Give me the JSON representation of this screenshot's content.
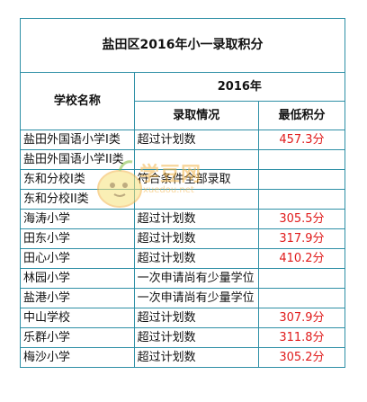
{
  "table": {
    "title": "盐田区2016年小一录取积分",
    "header": {
      "school_name": "学校名称",
      "year": "2016年",
      "admission": "录取情况",
      "min_score": "最低积分"
    },
    "rows": [
      {
        "school": "盐田外国语小学I类",
        "status": "超过计划数",
        "score": "457.3分"
      },
      {
        "school": "盐田外国语小学II类",
        "status": "",
        "score": ""
      },
      {
        "school": "东和分校I类",
        "status": "符合条件全部录取",
        "score": ""
      },
      {
        "school": "东和分校II类",
        "status": "",
        "score": ""
      },
      {
        "school": "海涛小学",
        "status": "超过计划数",
        "score": "305.5分"
      },
      {
        "school": "田东小学",
        "status": "超过计划数",
        "score": "317.9分"
      },
      {
        "school": "田心小学",
        "status": "超过计划数",
        "score": "410.2分"
      },
      {
        "school": "林园小学",
        "status": "一次申请尚有少量学位",
        "score": ""
      },
      {
        "school": "盐港小学",
        "status": "一次申请尚有少量学位",
        "score": ""
      },
      {
        "school": "中山学校",
        "status": "超过计划数",
        "score": "307.9分"
      },
      {
        "school": "乐群小学",
        "status": "超过计划数",
        "score": "311.8分"
      },
      {
        "school": "梅沙小学",
        "status": "超过计划数",
        "score": "305.2分"
      }
    ]
  },
  "watermark": {
    "text": "学豆网",
    "url": "xuedou.net"
  },
  "colors": {
    "border": "#2e8fa6",
    "score": "#e01b1b"
  }
}
